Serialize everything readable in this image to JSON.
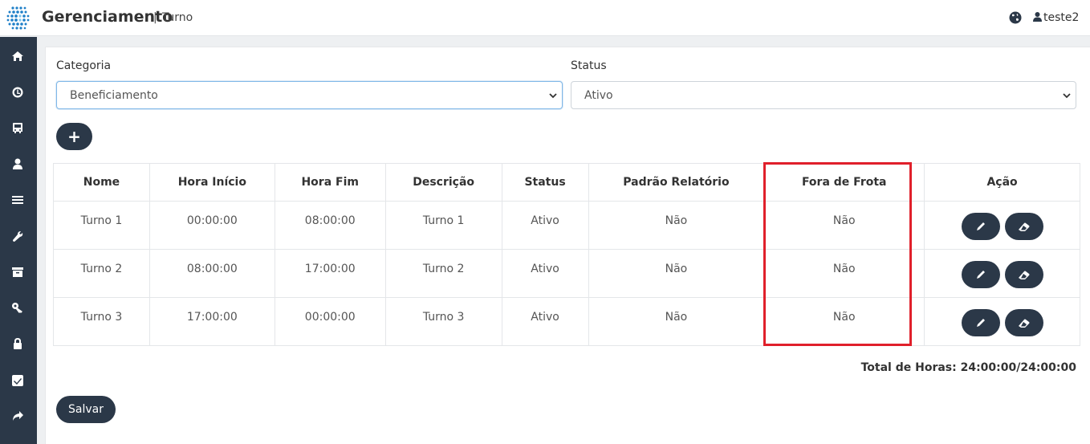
{
  "header": {
    "app_title": "Gerenciamento",
    "separator": "|",
    "page_title": "Turno",
    "username": "teste2",
    "globe_icon": "globe-icon",
    "user_icon": "user-icon"
  },
  "sidebar": {
    "items": [
      {
        "icon": "home-icon"
      },
      {
        "icon": "clock-icon"
      },
      {
        "icon": "bus-icon"
      },
      {
        "icon": "user-icon"
      },
      {
        "icon": "list-icon"
      },
      {
        "icon": "wrench-icon"
      },
      {
        "icon": "archive-icon"
      },
      {
        "icon": "key-icon"
      },
      {
        "icon": "lock-icon"
      },
      {
        "icon": "checkbox-icon"
      },
      {
        "icon": "share-icon"
      }
    ]
  },
  "filters": {
    "categoria_label": "Categoria",
    "categoria_value": "Beneficiamento",
    "status_label": "Status",
    "status_value": "Ativo"
  },
  "add_button": "+",
  "table": {
    "headers": [
      "Nome",
      "Hora Início",
      "Hora Fim",
      "Descrição",
      "Status",
      "Padrão Relatório",
      "Fora de Frota",
      "Ação"
    ],
    "rows": [
      [
        "Turno 1",
        "00:00:00",
        "08:00:00",
        "Turno 1",
        "Ativo",
        "Não",
        "Não"
      ],
      [
        "Turno 2",
        "08:00:00",
        "17:00:00",
        "Turno 2",
        "Ativo",
        "Não",
        "Não"
      ],
      [
        "Turno 3",
        "17:00:00",
        "00:00:00",
        "Turno 3",
        "Ativo",
        "Não",
        "Não"
      ]
    ]
  },
  "total_hours": "Total de Horas: 24:00:00/24:00:00",
  "save_button": "Salvar",
  "colors": {
    "sidebar_bg": "#2b3848",
    "highlight": "#e0202b"
  }
}
